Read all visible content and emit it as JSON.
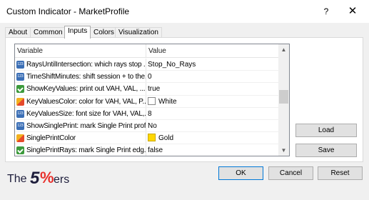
{
  "window": {
    "title": "Custom Indicator - MarketProfile",
    "help_glyph": "?",
    "close_glyph": "✕"
  },
  "tabs": [
    {
      "label": "About"
    },
    {
      "label": "Common"
    },
    {
      "label": "Inputs",
      "active": true
    },
    {
      "label": "Colors"
    },
    {
      "label": "Visualization"
    }
  ],
  "grid": {
    "header": {
      "variable": "Variable",
      "value": "Value"
    },
    "rows": [
      {
        "icon": "integer-type-icon",
        "name": "RaysUntilIntersection: which rays stop ...",
        "value": "Stop_No_Rays"
      },
      {
        "icon": "integer-type-icon",
        "name": "TimeShiftMinutes: shift session + to the...",
        "value": "0"
      },
      {
        "icon": "boolean-type-icon",
        "name": "ShowKeyValues: print out VAH, VAL, ...",
        "value": "true"
      },
      {
        "icon": "color-type-icon",
        "name": "KeyValuesColor: color for VAH, VAL, P...",
        "value": "White",
        "swatch": "#ffffff"
      },
      {
        "icon": "integer-type-icon",
        "name": "KeyValuesSize: font size for VAH, VAL,...",
        "value": "8"
      },
      {
        "icon": "integer-type-icon",
        "name": "ShowSinglePrint: mark Single Print prof...",
        "value": "No"
      },
      {
        "icon": "color-type-icon",
        "name": "SinglePrintColor",
        "value": "Gold",
        "swatch": "#ffd700"
      },
      {
        "icon": "boolean-type-icon",
        "name": "SinglePrintRays: mark Single Print edg...",
        "value": "false"
      }
    ]
  },
  "buttons": {
    "load": "Load",
    "save": "Save",
    "ok": "OK",
    "cancel": "Cancel",
    "reset": "Reset"
  },
  "logo": {
    "the": "The",
    "five": "5",
    "pct": "%",
    "ers": "ers"
  },
  "colors": {
    "accent": "#0078d7",
    "logo_red": "#e8302c",
    "logo_navy": "#1d1d3b"
  }
}
